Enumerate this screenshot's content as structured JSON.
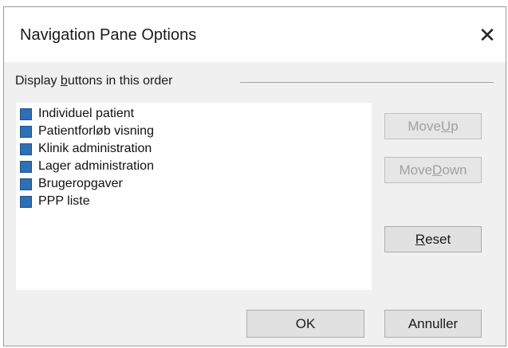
{
  "window": {
    "title": "Navigation Pane Options",
    "close_glyph": "✕"
  },
  "group": {
    "label_pre": "Display ",
    "label_accel": "b",
    "label_post": "uttons in this order"
  },
  "items": [
    {
      "label": "Individuel patient",
      "checked": true
    },
    {
      "label": "Patientforløb visning",
      "checked": true
    },
    {
      "label": "Klinik administration",
      "checked": true
    },
    {
      "label": "Lager administration",
      "checked": true
    },
    {
      "label": "Brugeropgaver",
      "checked": true
    },
    {
      "label": "PPP liste",
      "checked": true
    }
  ],
  "buttons": {
    "move_up": {
      "pre": "Move ",
      "accel": "U",
      "post": "p",
      "enabled": false
    },
    "move_down": {
      "pre": "Move ",
      "accel": "D",
      "post": "own",
      "enabled": false
    },
    "reset": {
      "pre": "",
      "accel": "R",
      "post": "eset",
      "enabled": true
    },
    "ok": "OK",
    "cancel": "Annuller"
  },
  "colors": {
    "checkbox": "#2f6fb4",
    "dialog_bg": "#f0f0f0",
    "button_bg": "#e1e1e1",
    "disabled_text": "#a0a0a0"
  }
}
